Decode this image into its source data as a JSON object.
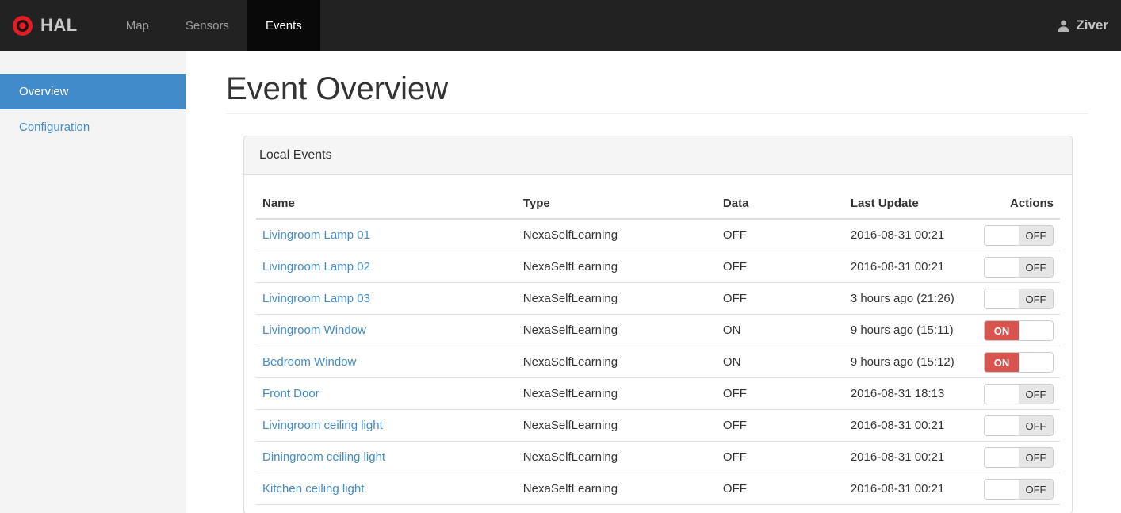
{
  "navbar": {
    "brand": "HAL",
    "items": [
      {
        "label": "Map",
        "active": false
      },
      {
        "label": "Sensors",
        "active": false
      },
      {
        "label": "Events",
        "active": true
      }
    ],
    "user": {
      "name": "Ziver"
    }
  },
  "sidebar": {
    "items": [
      {
        "label": "Overview",
        "active": true
      },
      {
        "label": "Configuration",
        "active": false
      }
    ]
  },
  "main": {
    "title": "Event Overview",
    "panel": {
      "title": "Local Events",
      "table": {
        "columns": [
          "Name",
          "Type",
          "Data",
          "Last Update",
          "Actions"
        ],
        "rows": [
          {
            "name": "Livingroom Lamp 01",
            "type": "NexaSelfLearning",
            "data": "OFF",
            "last_update": "2016-08-31 00:21",
            "toggle": "OFF"
          },
          {
            "name": "Livingroom Lamp 02",
            "type": "NexaSelfLearning",
            "data": "OFF",
            "last_update": "2016-08-31 00:21",
            "toggle": "OFF"
          },
          {
            "name": "Livingroom Lamp 03",
            "type": "NexaSelfLearning",
            "data": "OFF",
            "last_update": "3 hours ago (21:26)",
            "toggle": "OFF"
          },
          {
            "name": "Livingroom Window",
            "type": "NexaSelfLearning",
            "data": "ON",
            "last_update": "9 hours ago (15:11)",
            "toggle": "ON"
          },
          {
            "name": "Bedroom Window",
            "type": "NexaSelfLearning",
            "data": "ON",
            "last_update": "9 hours ago (15:12)",
            "toggle": "ON"
          },
          {
            "name": "Front Door",
            "type": "NexaSelfLearning",
            "data": "OFF",
            "last_update": "2016-08-31 18:13",
            "toggle": "OFF"
          },
          {
            "name": "Livingroom ceiling light",
            "type": "NexaSelfLearning",
            "data": "OFF",
            "last_update": "2016-08-31 00:21",
            "toggle": "OFF"
          },
          {
            "name": "Diningroom ceiling light",
            "type": "NexaSelfLearning",
            "data": "OFF",
            "last_update": "2016-08-31 00:21",
            "toggle": "OFF"
          },
          {
            "name": "Kitchen ceiling light",
            "type": "NexaSelfLearning",
            "data": "OFF",
            "last_update": "2016-08-31 00:21",
            "toggle": "OFF"
          }
        ]
      }
    }
  },
  "colors": {
    "accent_blue": "#428bca",
    "toggle_on_red": "#d9534f",
    "navbar_bg": "#222222",
    "navbar_active_bg": "#090909",
    "brand_red": "#e41c23",
    "sidebar_bg": "#f4f4f4"
  }
}
